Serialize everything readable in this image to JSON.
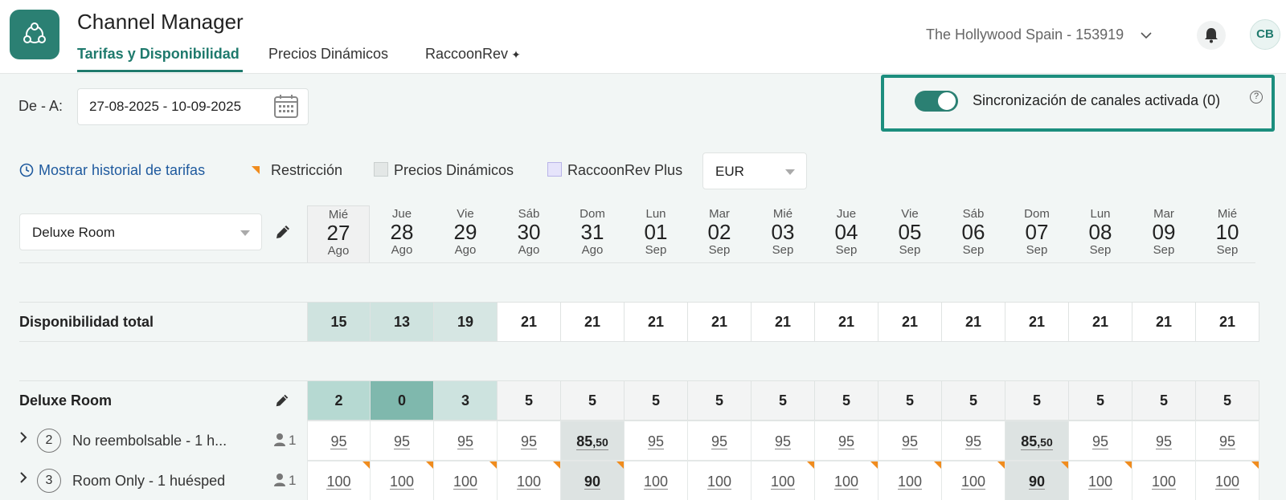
{
  "header": {
    "title": "Channel Manager",
    "tabs": [
      {
        "label": "Tarifas y Disponibilidad",
        "active": true
      },
      {
        "label": "Precios Dinámicos",
        "active": false
      },
      {
        "label": "RaccoonRev",
        "active": false
      }
    ],
    "property": "The Hollywood Spain - 153919",
    "avatar": "CB"
  },
  "toolbar": {
    "date_label": "De - A:",
    "date_range": "27-08-2025 - 10-09-2025",
    "sync_label": "Sincronización de canales activada (0)",
    "sync_on": true,
    "help": "?"
  },
  "legend": {
    "history": "Mostrar historial de tarifas",
    "restriction": "Restricción",
    "dynamic": "Precios Dinámicos",
    "raccoon": "RaccoonRev Plus",
    "currency": "EUR"
  },
  "room_select": "Deluxe Room",
  "dates": [
    {
      "dow": "Mié",
      "day": "27",
      "mon": "Ago"
    },
    {
      "dow": "Jue",
      "day": "28",
      "mon": "Ago"
    },
    {
      "dow": "Vie",
      "day": "29",
      "mon": "Ago"
    },
    {
      "dow": "Sáb",
      "day": "30",
      "mon": "Ago"
    },
    {
      "dow": "Dom",
      "day": "31",
      "mon": "Ago"
    },
    {
      "dow": "Lun",
      "day": "01",
      "mon": "Sep"
    },
    {
      "dow": "Mar",
      "day": "02",
      "mon": "Sep"
    },
    {
      "dow": "Mié",
      "day": "03",
      "mon": "Sep"
    },
    {
      "dow": "Jue",
      "day": "04",
      "mon": "Sep"
    },
    {
      "dow": "Vie",
      "day": "05",
      "mon": "Sep"
    },
    {
      "dow": "Sáb",
      "day": "06",
      "mon": "Sep"
    },
    {
      "dow": "Dom",
      "day": "07",
      "mon": "Sep"
    },
    {
      "dow": "Lun",
      "day": "08",
      "mon": "Sep"
    },
    {
      "dow": "Mar",
      "day": "09",
      "mon": "Sep"
    },
    {
      "dow": "Mié",
      "day": "10",
      "mon": "Sep"
    }
  ],
  "availability": {
    "label": "Disponibilidad total",
    "values": [
      "15",
      "13",
      "19",
      "21",
      "21",
      "21",
      "21",
      "21",
      "21",
      "21",
      "21",
      "21",
      "21",
      "21",
      "21"
    ],
    "colors": [
      "#cfe3df",
      "#cfe3df",
      "#d6e6e3",
      "#ffffff",
      "#ffffff",
      "#ffffff",
      "#ffffff",
      "#ffffff",
      "#ffffff",
      "#ffffff",
      "#ffffff",
      "#ffffff",
      "#ffffff",
      "#ffffff",
      "#ffffff"
    ]
  },
  "room": {
    "label": "Deluxe Room",
    "values": [
      "2",
      "0",
      "3",
      "5",
      "5",
      "5",
      "5",
      "5",
      "5",
      "5",
      "5",
      "5",
      "5",
      "5",
      "5"
    ],
    "colors": [
      "#b6d9d2",
      "#7fb8ad",
      "#cde3df",
      "#f3f4f4",
      "#f3f4f4",
      "#f3f4f4",
      "#f3f4f4",
      "#f3f4f4",
      "#f3f4f4",
      "#f3f4f4",
      "#f3f4f4",
      "#f3f4f4",
      "#f3f4f4",
      "#f3f4f4",
      "#f3f4f4"
    ]
  },
  "rates": [
    {
      "num": "2",
      "label": "No reembolsable - 1 h...",
      "occupancy": "1",
      "values": [
        {
          "v": "95"
        },
        {
          "v": "95"
        },
        {
          "v": "95"
        },
        {
          "v": "95"
        },
        {
          "v": "85",
          "dec": ",50",
          "dyn": true
        },
        {
          "v": "95"
        },
        {
          "v": "95"
        },
        {
          "v": "95"
        },
        {
          "v": "95"
        },
        {
          "v": "95"
        },
        {
          "v": "95"
        },
        {
          "v": "85",
          "dec": ",50",
          "dyn": true
        },
        {
          "v": "95"
        },
        {
          "v": "95"
        },
        {
          "v": "95"
        }
      ]
    },
    {
      "num": "3",
      "label": "Room Only - 1 huésped",
      "occupancy": "1",
      "values": [
        {
          "v": "100",
          "r": true
        },
        {
          "v": "100",
          "r": true
        },
        {
          "v": "100",
          "r": true
        },
        {
          "v": "100",
          "r": true
        },
        {
          "v": "90",
          "dyn": true,
          "r": true
        },
        {
          "v": "100"
        },
        {
          "v": "100"
        },
        {
          "v": "100",
          "r": true
        },
        {
          "v": "100",
          "r": true
        },
        {
          "v": "100",
          "r": true
        },
        {
          "v": "100",
          "r": true
        },
        {
          "v": "90",
          "dyn": true,
          "r": true
        },
        {
          "v": "100",
          "r": true
        },
        {
          "v": "100"
        },
        {
          "v": "100",
          "r": true
        }
      ]
    }
  ]
}
